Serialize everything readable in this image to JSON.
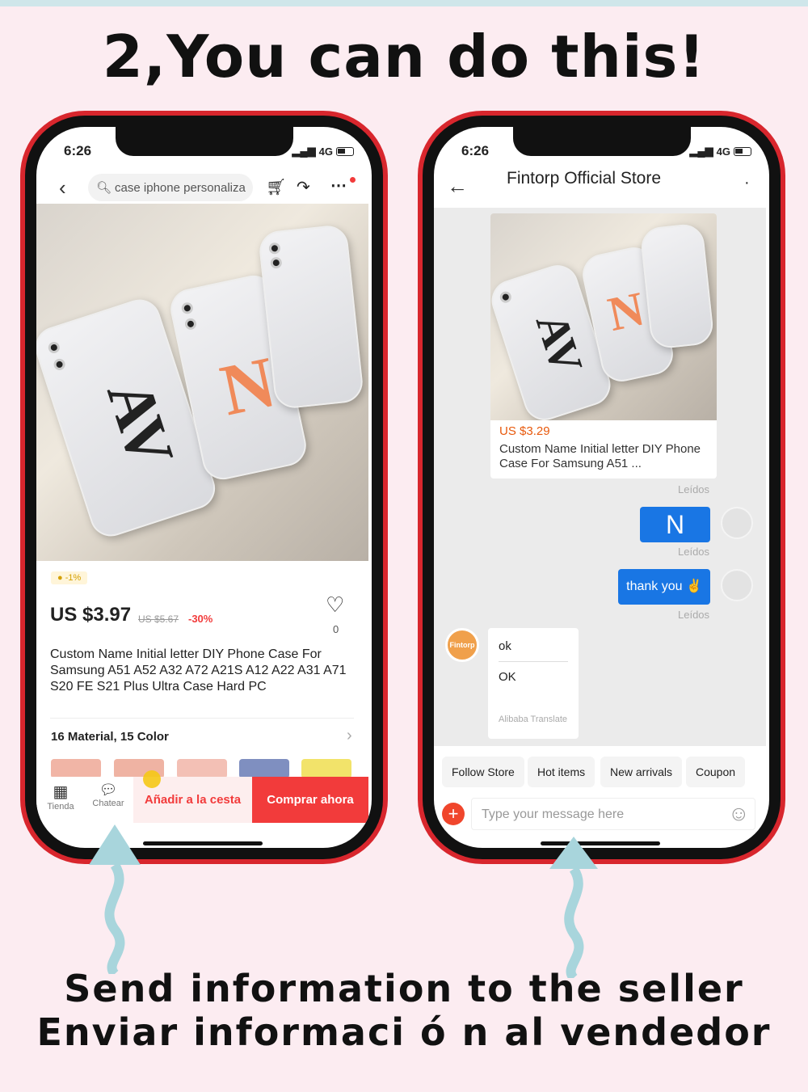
{
  "headline": "2,You can do this!",
  "footer": {
    "line1": "Send information to the seller",
    "line2": "Enviar informaci ó n al vendedor"
  },
  "colors": {
    "phone_frame": "#d8262d",
    "accent_red": "#f23b3b",
    "chat_blue": "#1976e4",
    "arrow": "#a8d5dc",
    "price_orange": "#e8590c"
  },
  "left_phone": {
    "status": {
      "time": "6:26",
      "network": "4G"
    },
    "search": {
      "placeholder": "case iphone personaliza"
    },
    "icons": [
      "back-icon",
      "search-icon",
      "cart-icon",
      "share-icon",
      "more-icon"
    ],
    "coin_badge": "-1%",
    "price": "US $3.97",
    "old_price": "US $5.67",
    "discount": "-30%",
    "wishlist_count": "0",
    "title": "Custom Name Initial letter DIY Phone Case For Samsung A51 A52 A32 A72 A21S A12 A22 A31 A71 S20 FE S21 Plus Ultra Case Hard PC",
    "variants": "16 Material, 15 Color",
    "bottom": {
      "store": "Tienda",
      "chat": "Chatear",
      "add_cart": "Añadir a la cesta",
      "buy_now": "Comprar ahora"
    }
  },
  "right_phone": {
    "status": {
      "time": "6:26",
      "network": "4G"
    },
    "header_title": "Fintorp Official Store",
    "product_card": {
      "price": "US $3.29",
      "title": "Custom Name Initial letter DIY Phone Case For Samsung A51 ..."
    },
    "messages": [
      {
        "from": "me",
        "text": "N",
        "status": "Leídos"
      },
      {
        "from": "me",
        "text": "thank you ✌",
        "status": "Leídos"
      },
      {
        "from": "seller",
        "text": "ok",
        "translation": "OK",
        "translator": "Alibaba Translate"
      }
    ],
    "read_status_card": "Leídos",
    "seller_avatar": "Fintorp",
    "chips": [
      "Follow Store",
      "Hot items",
      "New arrivals",
      "Coupon"
    ],
    "input_placeholder": "Type your message here"
  }
}
